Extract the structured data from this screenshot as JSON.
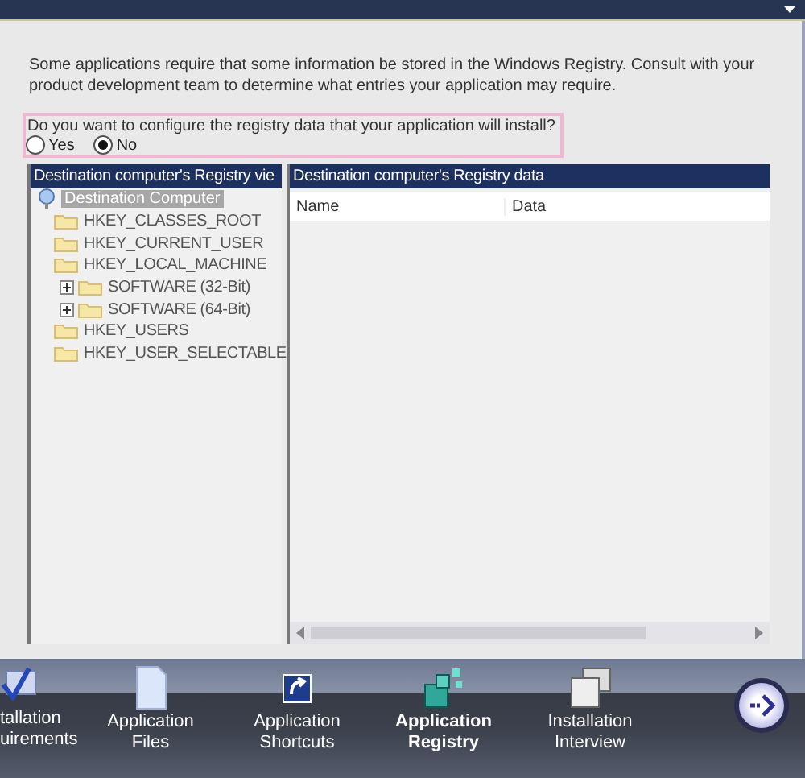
{
  "intro": "Some applications require that some information be stored in the Windows Registry. Consult with your product development team to determine what entries your application may require.",
  "question": {
    "label": "Do you want to configure the registry data that your application will install?",
    "options": [
      {
        "label": "Yes",
        "selected": false
      },
      {
        "label": "No",
        "selected": true
      }
    ]
  },
  "tree_pane": {
    "title": "Destination computer's Registry vie",
    "root": {
      "label": "Destination Computer",
      "selected": true,
      "children": [
        {
          "label": "HKEY_CLASSES_ROOT"
        },
        {
          "label": "HKEY_CURRENT_USER"
        },
        {
          "label": "HKEY_LOCAL_MACHINE",
          "children": [
            {
              "label": "SOFTWARE (32-Bit)",
              "expanded": false
            },
            {
              "label": "SOFTWARE (64-Bit)",
              "expanded": false
            }
          ]
        },
        {
          "label": "HKEY_USERS"
        },
        {
          "label": "HKEY_USER_SELECTABLE"
        }
      ]
    }
  },
  "data_pane": {
    "title": "Destination computer's Registry data",
    "columns": [
      "Name",
      "Data"
    ]
  },
  "nav": [
    {
      "kind": "requirements",
      "lines": [
        "tallation",
        "uirements"
      ],
      "selected": false
    },
    {
      "kind": "files",
      "lines": [
        "Application",
        "Files"
      ],
      "selected": false
    },
    {
      "kind": "shortcuts",
      "lines": [
        "Application",
        "Shortcuts"
      ],
      "selected": false
    },
    {
      "kind": "registry",
      "lines": [
        "Application",
        "Registry"
      ],
      "selected": true
    },
    {
      "kind": "interview",
      "lines": [
        "Installation",
        "Interview"
      ],
      "selected": false
    }
  ]
}
